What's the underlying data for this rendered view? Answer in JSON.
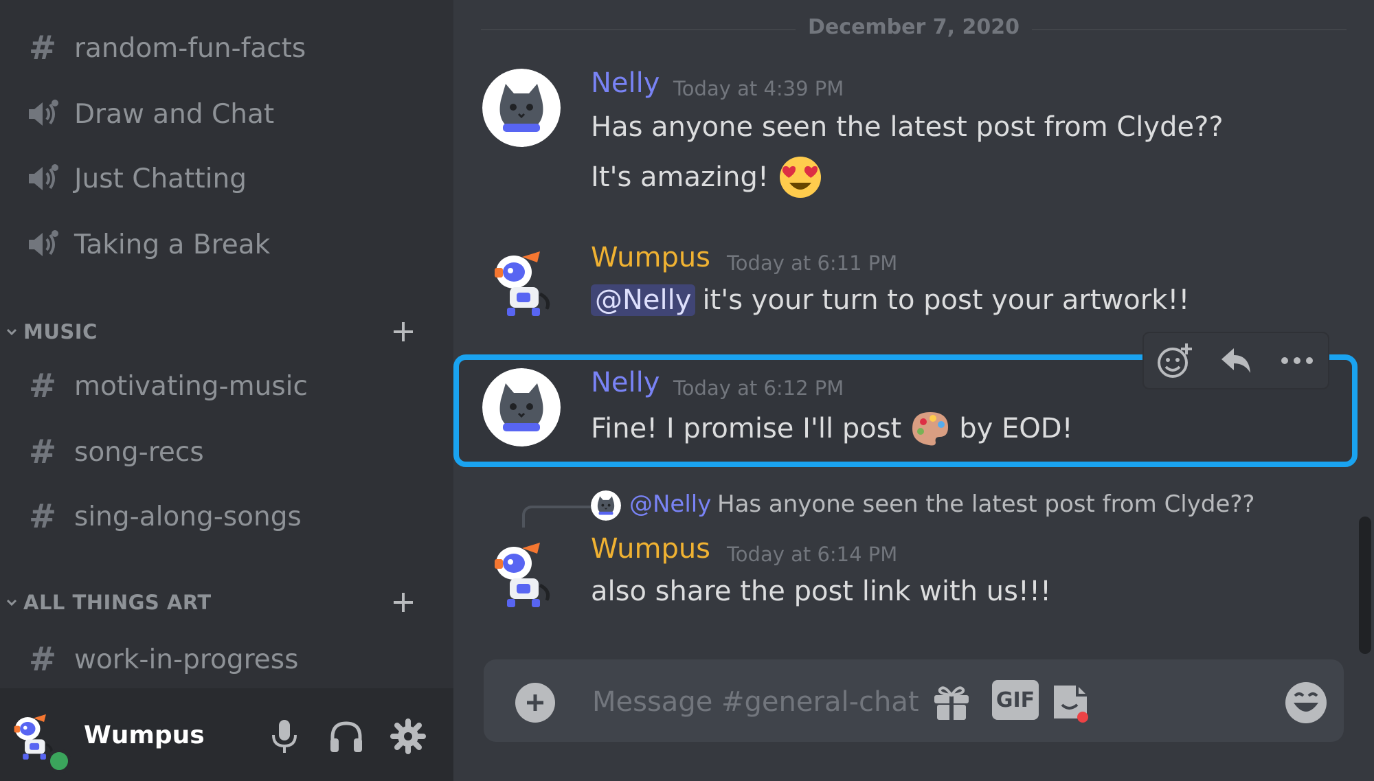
{
  "sidebar": {
    "channels_top": [
      {
        "type": "text",
        "label": "random-fun-facts"
      },
      {
        "type": "voice",
        "label": "Draw and Chat"
      },
      {
        "type": "voice",
        "label": "Just Chatting"
      },
      {
        "type": "voice",
        "label": "Taking a Break"
      }
    ],
    "categories": [
      {
        "label": "MUSIC",
        "channels": [
          "motivating-music",
          "song-recs",
          "sing-along-songs"
        ]
      },
      {
        "label": "ALL THINGS ART",
        "channels": [
          "work-in-progress"
        ]
      }
    ],
    "user": {
      "name": "Wumpus",
      "status": "online"
    }
  },
  "chat": {
    "date_divider": "December 7, 2020",
    "messages": [
      {
        "author": "Nelly",
        "author_color": "#7983f5",
        "timestamp": "Today at 4:39 PM",
        "lines": [
          "Has anyone seen the latest post from Clyde??",
          "It's amazing!"
        ]
      },
      {
        "author": "Wumpus",
        "author_color": "#f0b232",
        "timestamp": "Today at 6:11 PM",
        "mention": "@Nelly",
        "text": "it's your turn to post your artwork!!"
      },
      {
        "author": "Nelly",
        "author_color": "#7983f5",
        "timestamp": "Today at 6:12 PM",
        "text_before": "Fine! I promise I'll post",
        "text_after": "by EOD!",
        "highlighted": true
      },
      {
        "author": "Wumpus",
        "author_color": "#f0b232",
        "timestamp": "Today at 6:14 PM",
        "reply": {
          "mention": "@Nelly",
          "text": "Has anyone seen the latest post from Clyde??"
        },
        "text": "also share the post link with us!!!"
      }
    ],
    "composer": {
      "placeholder": "Message #general-chat",
      "gif_label": "GIF"
    }
  },
  "colors": {
    "highlight_border": "#1aa3f0",
    "online": "#3ba55c",
    "nelly": "#7983f5",
    "wumpus": "#f0b232"
  },
  "icons": [
    "hash-icon",
    "voice-channel-icon",
    "chevron-down-icon",
    "plus-icon",
    "microphone-icon",
    "headphones-icon",
    "gear-icon",
    "add-reaction-icon",
    "reply-icon",
    "more-icon",
    "gift-icon",
    "gif-icon",
    "sticker-icon",
    "emoji-icon",
    "heart-eyes-emoji",
    "palette-emoji"
  ]
}
